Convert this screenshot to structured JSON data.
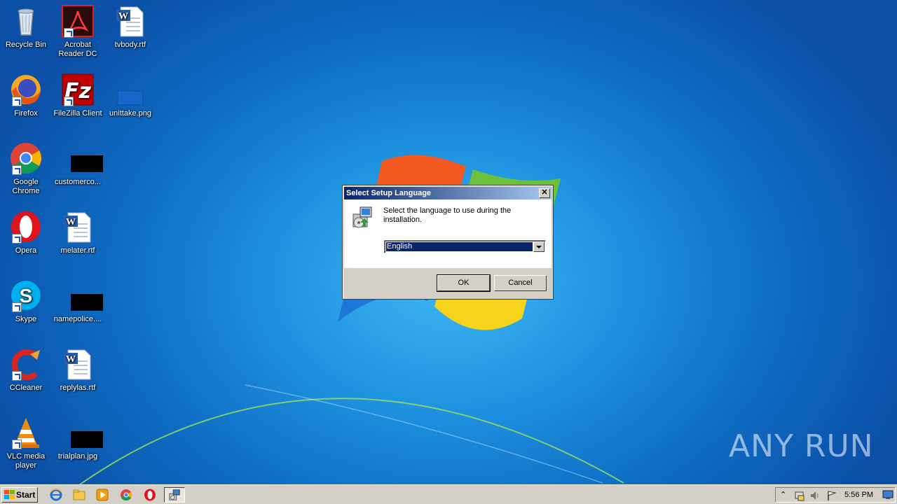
{
  "desktop": {
    "icons": [
      {
        "label": "Recycle Bin"
      },
      {
        "label": "Acrobat Reader DC"
      },
      {
        "label": "tvbody.rtf"
      },
      {
        "label": "Firefox"
      },
      {
        "label": "FileZilla Client"
      },
      {
        "label": "unittake.png"
      },
      {
        "label": "Google Chrome"
      },
      {
        "label": "customerco..."
      },
      {
        "label": "Opera"
      },
      {
        "label": "melater.rtf"
      },
      {
        "label": "Skype"
      },
      {
        "label": "namepolice...."
      },
      {
        "label": "CCleaner"
      },
      {
        "label": "replylas.rtf"
      },
      {
        "label": "VLC media player"
      },
      {
        "label": "trialplan.jpg"
      }
    ],
    "watermark": "ANY RUN"
  },
  "dialog": {
    "title": "Select Setup Language",
    "prompt": "Select the language to use during the installation.",
    "language_selected": "English",
    "ok_label": "OK",
    "cancel_label": "Cancel",
    "close_glyph": "✕"
  },
  "taskbar": {
    "start_label": "Start",
    "clock": "5:56 PM",
    "tray_expand_glyph": "⌃"
  },
  "colors": {
    "titlebar_start": "#0a246a",
    "selection": "#0a246a",
    "desktop": "#1e93e0"
  }
}
